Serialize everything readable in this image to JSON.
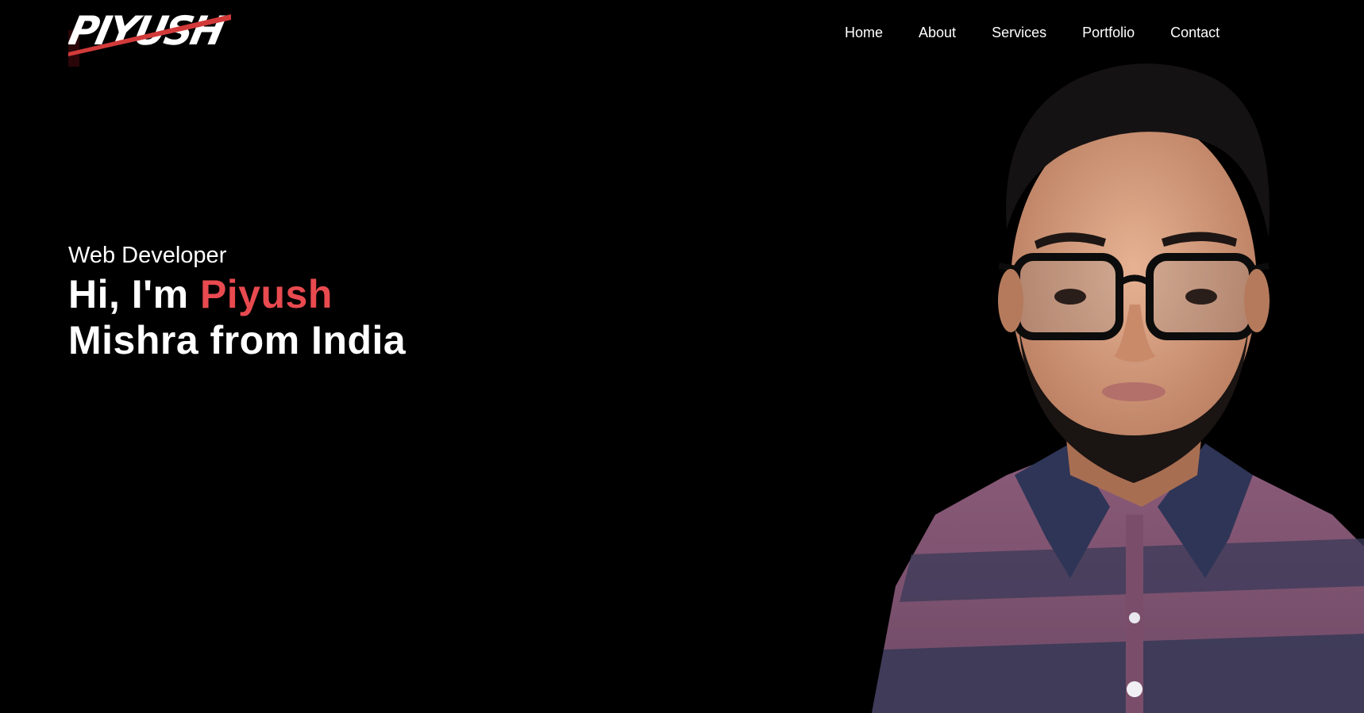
{
  "logo": {
    "text": "PIYUSH",
    "icon": "brush-signature-logo"
  },
  "nav": {
    "items": [
      {
        "label": "Home"
      },
      {
        "label": "About"
      },
      {
        "label": "Services"
      },
      {
        "label": "Portfolio"
      },
      {
        "label": "Contact"
      }
    ]
  },
  "hero": {
    "role": "Web Developer",
    "greeting": "Hi, I'm",
    "first_name": "Piyush",
    "line2": "Mishra from India"
  },
  "colors": {
    "background": "#000000",
    "text": "#ffffff",
    "accent": "#e84a4f"
  }
}
